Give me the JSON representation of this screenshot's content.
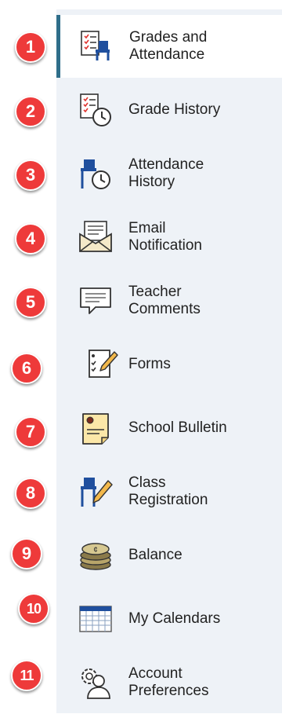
{
  "accent_color": "#2f6e8a",
  "badge_color": "#ee3a3a",
  "menu": {
    "items": [
      {
        "label": "Grades and\nAttendance",
        "badge": "1",
        "icon": "grades-attendance-icon",
        "active": true
      },
      {
        "label": "Grade History",
        "badge": "2",
        "icon": "grade-history-icon"
      },
      {
        "label": "Attendance\nHistory",
        "badge": "3",
        "icon": "attendance-history-icon"
      },
      {
        "label": "Email\nNotification",
        "badge": "4",
        "icon": "email-notification-icon"
      },
      {
        "label": "Teacher\nComments",
        "badge": "5",
        "icon": "teacher-comments-icon"
      },
      {
        "label": "Forms",
        "badge": "6",
        "icon": "forms-icon"
      },
      {
        "label": "School Bulletin",
        "badge": "7",
        "icon": "school-bulletin-icon"
      },
      {
        "label": "Class\nRegistration",
        "badge": "8",
        "icon": "class-registration-icon"
      },
      {
        "label": "Balance",
        "badge": "9",
        "icon": "balance-icon"
      },
      {
        "label": "My Calendars",
        "badge": "10",
        "icon": "my-calendars-icon"
      },
      {
        "label": "Account\nPreferences",
        "badge": "11",
        "icon": "account-preferences-icon"
      }
    ]
  }
}
